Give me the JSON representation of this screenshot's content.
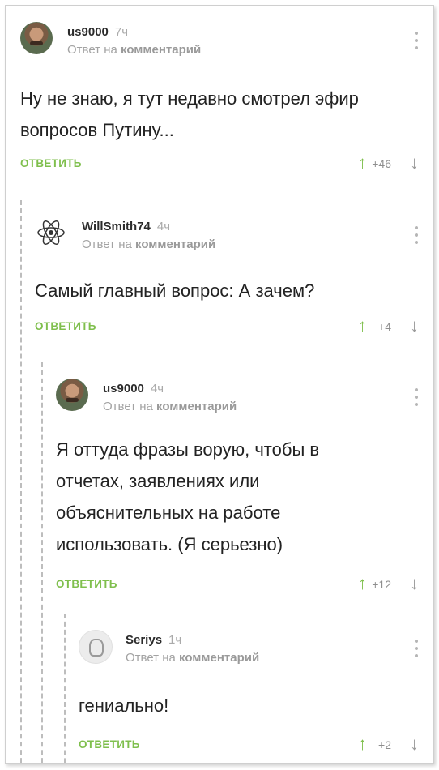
{
  "comments": [
    {
      "username": "us9000",
      "time": "7ч",
      "reply_prefix": "Ответ на",
      "reply_target": "комментарий",
      "text": "Ну не знаю, я тут недавно смотрел эфир вопросов Путину...",
      "reply_label": "ОТВЕТИТЬ",
      "rating": "+46",
      "avatar": "photo"
    },
    {
      "username": "WillSmith74",
      "time": "4ч",
      "reply_prefix": "Ответ на",
      "reply_target": "комментарий",
      "text": "Самый главный вопрос: А зачем?",
      "reply_label": "ОТВЕТИТЬ",
      "rating": "+4",
      "avatar": "atom"
    },
    {
      "username": "us9000",
      "time": "4ч",
      "reply_prefix": "Ответ на",
      "reply_target": "комментарий",
      "text": "Я оттуда фразы ворую, чтобы в отчетах, заявлениях или объяснительных на работе использовать. (Я серьезно)",
      "reply_label": "ОТВЕТИТЬ",
      "rating": "+12",
      "avatar": "photo"
    },
    {
      "username": "Seriys",
      "time": "1ч",
      "reply_prefix": "Ответ на",
      "reply_target": "комментарий",
      "text": "гениально!",
      "reply_label": "ОТВЕТИТЬ",
      "rating": "+2",
      "avatar": "plain"
    }
  ],
  "icons": {
    "upvote": "arrow-up-icon",
    "downvote": "arrow-down-icon",
    "menu": "kebab-menu-icon"
  },
  "colors": {
    "accent": "#7fbf4d",
    "muted": "#a3a3a3",
    "thread": "#bdbdbd"
  }
}
